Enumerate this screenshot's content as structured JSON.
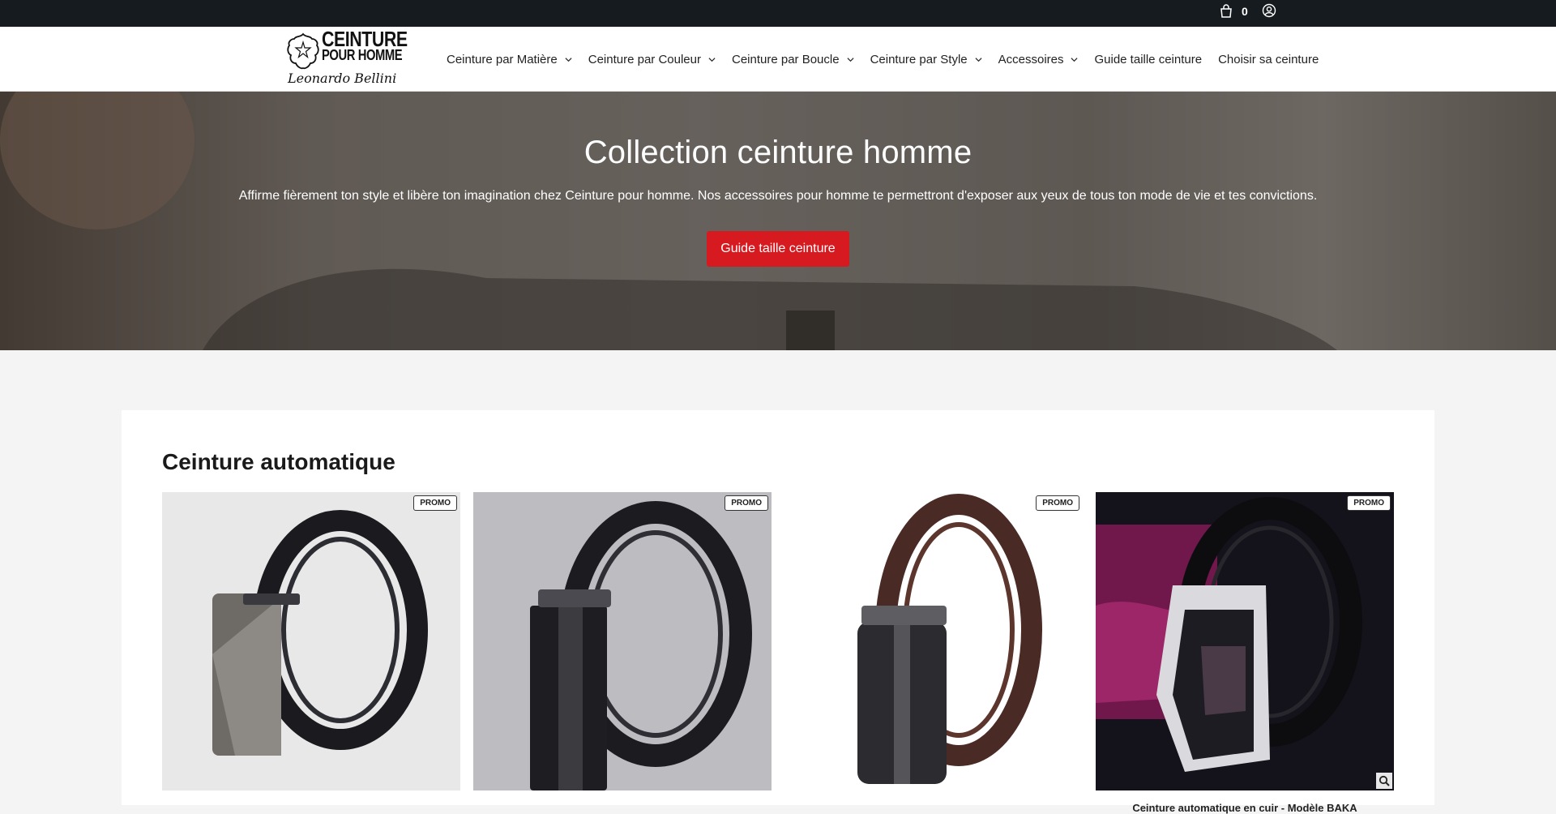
{
  "topbar": {
    "cart_count": "0",
    "cart_icon": "shopping-bag-icon",
    "account_icon": "user-circle-icon"
  },
  "header": {
    "logo": {
      "line1": "CEINTURE",
      "line2": "POUR HOMME",
      "signature": "Leonardo Bellini"
    },
    "nav": [
      {
        "label": "Ceinture par Matière",
        "dropdown": true
      },
      {
        "label": "Ceinture par Couleur",
        "dropdown": true
      },
      {
        "label": "Ceinture par Boucle",
        "dropdown": true
      },
      {
        "label": "Ceinture par Style",
        "dropdown": true
      },
      {
        "label": "Accessoires",
        "dropdown": true
      },
      {
        "label": "Guide taille ceinture",
        "dropdown": false
      },
      {
        "label": "Choisir sa ceinture",
        "dropdown": false
      }
    ]
  },
  "hero": {
    "title": "Collection ceinture homme",
    "text": "Affirme fièrement ton style et libère ton imagination chez Ceinture pour homme. Nos accessoires pour homme te permettront d'exposer aux yeux de tous ton mode de vie et tes convictions.",
    "cta": "Guide taille ceinture"
  },
  "collection": {
    "title": "Ceinture automatique",
    "products": [
      {
        "badge": "PROMO",
        "title": ""
      },
      {
        "badge": "PROMO",
        "title": ""
      },
      {
        "badge": "PROMO",
        "title": ""
      },
      {
        "badge": "PROMO",
        "title": "Ceinture automatique en cuir - Modèle BAKA"
      }
    ]
  },
  "colors": {
    "topbar": "#161b1f",
    "accent": "#d71920",
    "page_bg": "#f4f4f4"
  }
}
